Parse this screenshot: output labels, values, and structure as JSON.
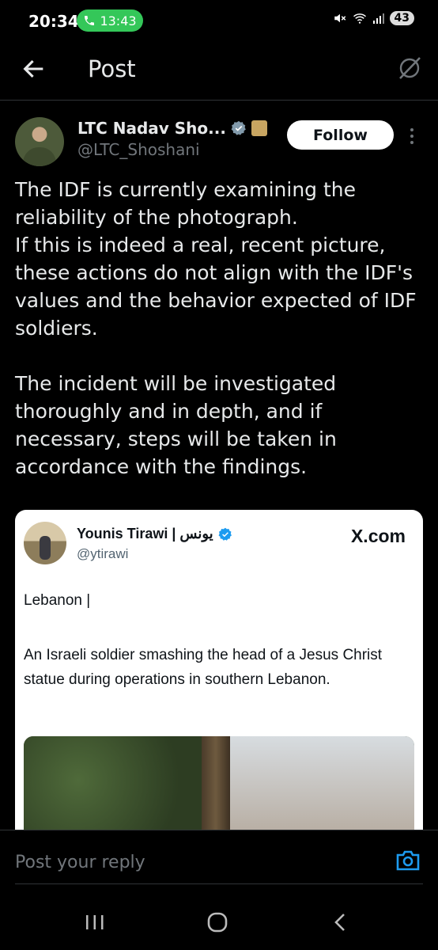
{
  "status_bar": {
    "time": "20:34",
    "call_duration": "13:43",
    "battery": "43"
  },
  "header": {
    "title": "Post"
  },
  "post": {
    "author_name": "LTC Nadav Sho...",
    "author_handle": "@LTC_Shoshani",
    "follow_label": "Follow",
    "text": "The IDF is currently examining the reliability of the photograph.\nIf this is indeed a real, recent picture, these actions do not align with the IDF's values and the behavior expected of IDF soldiers.\n\nThe incident will be investigated thoroughly and in depth, and if necessary, steps will be taken in accordance with the findings."
  },
  "quoted": {
    "author_name": "Younis Tirawi | يونس",
    "author_handle": "@ytirawi",
    "source": "X.com",
    "line1": "Lebanon |",
    "line2": "An Israeli soldier smashing the head of a Jesus Christ statue during operations in southern Lebanon."
  },
  "reply": {
    "placeholder": "Post your reply"
  },
  "colors": {
    "background": "#000000",
    "accent": "#1d9bf0",
    "call_green": "#34c759",
    "muted": "#71767b"
  },
  "icons": [
    "back-arrow-icon",
    "grok-icon",
    "verified-icon",
    "affiliate-badge-icon",
    "more-icon",
    "camera-icon",
    "nav-recents-icon",
    "nav-home-icon",
    "nav-back-icon",
    "phone-icon",
    "mute-icon",
    "wifi-icon",
    "signal-icon"
  ]
}
